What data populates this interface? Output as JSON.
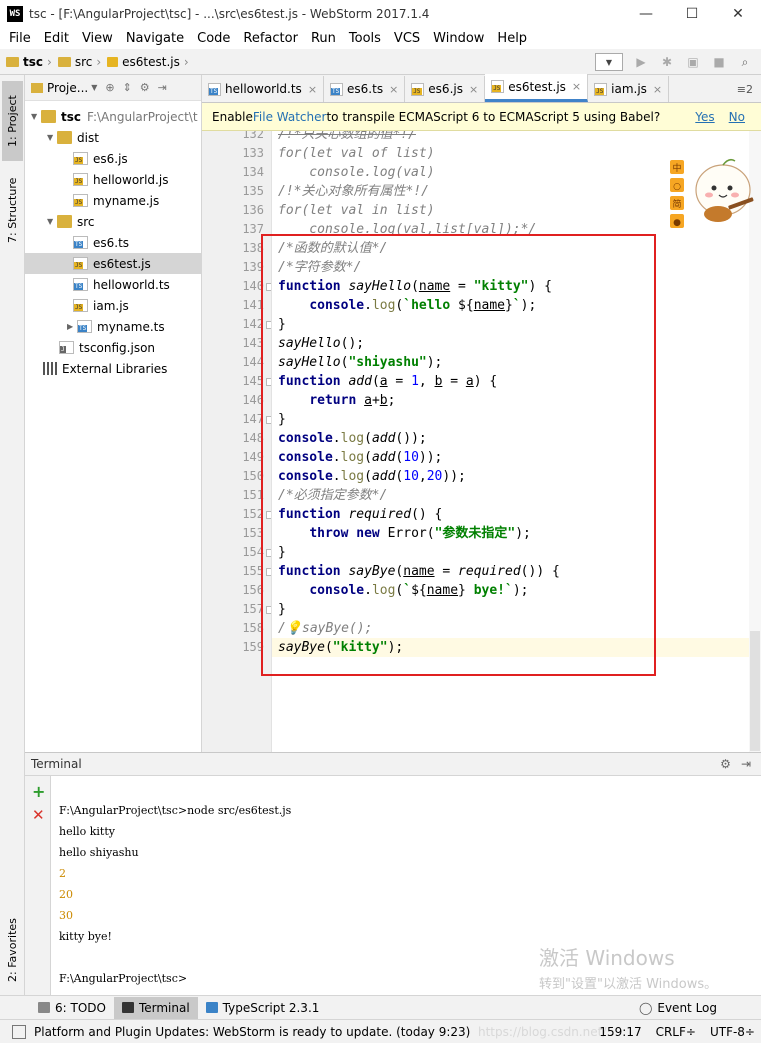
{
  "window": {
    "app_icon": "WS",
    "title": "tsc - [F:\\AngularProject\\tsc] - ...\\src\\es6test.js - WebStorm 2017.1.4",
    "buttons": [
      "—",
      "☐",
      "✕"
    ]
  },
  "menu": [
    "File",
    "Edit",
    "View",
    "Navigate",
    "Code",
    "Refactor",
    "Run",
    "Tools",
    "VCS",
    "Window",
    "Help"
  ],
  "breadcrumb": [
    "tsc",
    "src",
    "es6test.js"
  ],
  "left_tabs": {
    "project": "1: Project",
    "structure": "7: Structure",
    "favorites": "2: Favorites"
  },
  "project": {
    "header": "Proje...",
    "tree": [
      {
        "label": "tsc",
        "sub": "F:\\AngularProject\\t",
        "type": "folder",
        "expanded": true,
        "bold": true
      },
      {
        "label": "dist",
        "type": "folder",
        "expanded": true
      },
      {
        "label": "es6.js",
        "type": "js"
      },
      {
        "label": "helloworld.js",
        "type": "js"
      },
      {
        "label": "myname.js",
        "type": "js"
      },
      {
        "label": "src",
        "type": "folder",
        "expanded": true
      },
      {
        "label": "es6.ts",
        "type": "ts"
      },
      {
        "label": "es6test.js",
        "type": "js",
        "selected": true
      },
      {
        "label": "helloworld.ts",
        "type": "ts"
      },
      {
        "label": "iam.js",
        "type": "js"
      },
      {
        "label": "myname.ts",
        "type": "ts",
        "collapsed": true
      },
      {
        "label": "tsconfig.json",
        "type": "json"
      },
      {
        "label": "External Libraries",
        "type": "libs"
      }
    ]
  },
  "tabs": [
    {
      "label": "helloworld.ts",
      "type": "ts"
    },
    {
      "label": "es6.ts",
      "type": "ts"
    },
    {
      "label": "es6.js",
      "type": "js"
    },
    {
      "label": "es6test.js",
      "type": "js",
      "active": true
    },
    {
      "label": "iam.js",
      "type": "js"
    }
  ],
  "tabs_more": "≡2",
  "notification": {
    "before": "Enable ",
    "link": "File Watcher",
    "after": " to transpile ECMAScript 6 to ECMAScript 5 using Babel?",
    "yes": "Yes",
    "no": "No"
  },
  "code": {
    "current_line": 159,
    "lines": [
      {
        "n": 132,
        "html": "<span class=\"c strike\">/!*只关心数组的值*!/</span>"
      },
      {
        "n": 133,
        "html": "<span class=\"c\">for(let val of list)</span>"
      },
      {
        "n": 134,
        "html": "<span class=\"c\">    console.log(val)</span>"
      },
      {
        "n": 135,
        "html": "<span class=\"c\">/!*关心对象所有属性*!/</span>"
      },
      {
        "n": 136,
        "html": "<span class=\"c\">for(let val in list)</span>"
      },
      {
        "n": 137,
        "html": "<span class=\"c\">    console.log(val,list[val]);*/</span>"
      },
      {
        "n": 138,
        "html": "<span class=\"c\">/*函数的默认值*/</span>"
      },
      {
        "n": 139,
        "html": "<span class=\"c\">/*字符参数*/</span>"
      },
      {
        "n": 140,
        "html": "<span class=\"k\">function</span> <span class=\"fn\">sayHello</span>(<span class=\"u\">name</span> = <span class=\"s\">\"kitty\"</span>) {"
      },
      {
        "n": 141,
        "html": "    <span class=\"k\">console</span>.<span class=\"m\">log</span>(<span class=\"s\">`hello </span>${<span class=\"u\">name</span>}<span class=\"s\">`</span>);"
      },
      {
        "n": 142,
        "html": "}"
      },
      {
        "n": 143,
        "html": "<span class=\"fn\">sayHello</span>();"
      },
      {
        "n": 144,
        "html": "<span class=\"fn\">sayHello</span>(<span class=\"s\">\"shiyashu\"</span>);"
      },
      {
        "n": 145,
        "html": "<span class=\"k\">function</span> <span class=\"fn\">add</span>(<span class=\"u\">a</span> = <span class=\"n\">1</span>, <span class=\"u\">b</span> = <span class=\"u\">a</span>) {"
      },
      {
        "n": 146,
        "html": "    <span class=\"k\">return</span> <span class=\"u\">a</span>+<span class=\"u\">b</span>;"
      },
      {
        "n": 147,
        "html": "}"
      },
      {
        "n": 148,
        "html": "<span class=\"k\">console</span>.<span class=\"m\">log</span>(<span class=\"fn\">add</span>());"
      },
      {
        "n": 149,
        "html": "<span class=\"k\">console</span>.<span class=\"m\">log</span>(<span class=\"fn\">add</span>(<span class=\"n\">10</span>));"
      },
      {
        "n": 150,
        "html": "<span class=\"k\">console</span>.<span class=\"m\">log</span>(<span class=\"fn\">add</span>(<span class=\"n\">10</span>,<span class=\"n\">20</span>));"
      },
      {
        "n": 151,
        "html": "<span class=\"c\">/*必须指定参数*/</span>"
      },
      {
        "n": 152,
        "html": "<span class=\"k\">function</span> <span class=\"fn\">required</span>() {"
      },
      {
        "n": 153,
        "html": "    <span class=\"k\">throw new</span> Error(<span class=\"s\">\"参数未指定\"</span>);"
      },
      {
        "n": 154,
        "html": "}"
      },
      {
        "n": 155,
        "html": "<span class=\"k\">function</span> <span class=\"fn\">sayBye</span>(<span class=\"u\">name</span> = <span class=\"fn\">required</span>()) {"
      },
      {
        "n": 156,
        "html": "    <span class=\"k\">console</span>.<span class=\"m\">log</span>(<span class=\"s\">`</span>${<span class=\"u\">name</span>}<span class=\"s\"> bye!`</span>);"
      },
      {
        "n": 157,
        "html": "}"
      },
      {
        "n": 158,
        "html": "<span class=\"c\">/💡sayBye();</span>"
      },
      {
        "n": 159,
        "html": "<span class=\"fn\">sayBye</span>(<span class=\"s\">\"kitty\"</span>);"
      }
    ]
  },
  "terminal": {
    "title": "Terminal",
    "lines": [
      {
        "text": "F:\\AngularProject\\tsc>node src/es6test.js",
        "num": false
      },
      {
        "text": "hello kitty",
        "num": false
      },
      {
        "text": "hello shiyashu",
        "num": false
      },
      {
        "text": "2",
        "num": true
      },
      {
        "text": "20",
        "num": true
      },
      {
        "text": "30",
        "num": true
      },
      {
        "text": "kitty bye!",
        "num": false
      }
    ],
    "prompt": "F:\\AngularProject\\tsc>"
  },
  "watermark": {
    "line1": "激活 Windows",
    "line2": "转到\"设置\"以激活 Windows。"
  },
  "bottom_tabs": {
    "todo": "6: TODO",
    "terminal": "Terminal",
    "typescript": "TypeScript 2.3.1",
    "event_log": "Event Log"
  },
  "status": {
    "message": "Platform and Plugin Updates: WebStorm is ready to update. (today 9:23)",
    "blog": "https://blog.csdn.net/...",
    "position": "159:17",
    "line_sep": "CRLF÷",
    "encoding": "UTF-8÷"
  },
  "colors": {
    "accent": "#4083c9",
    "highlight_box": "#e02020",
    "current_line": "#fffae3"
  }
}
